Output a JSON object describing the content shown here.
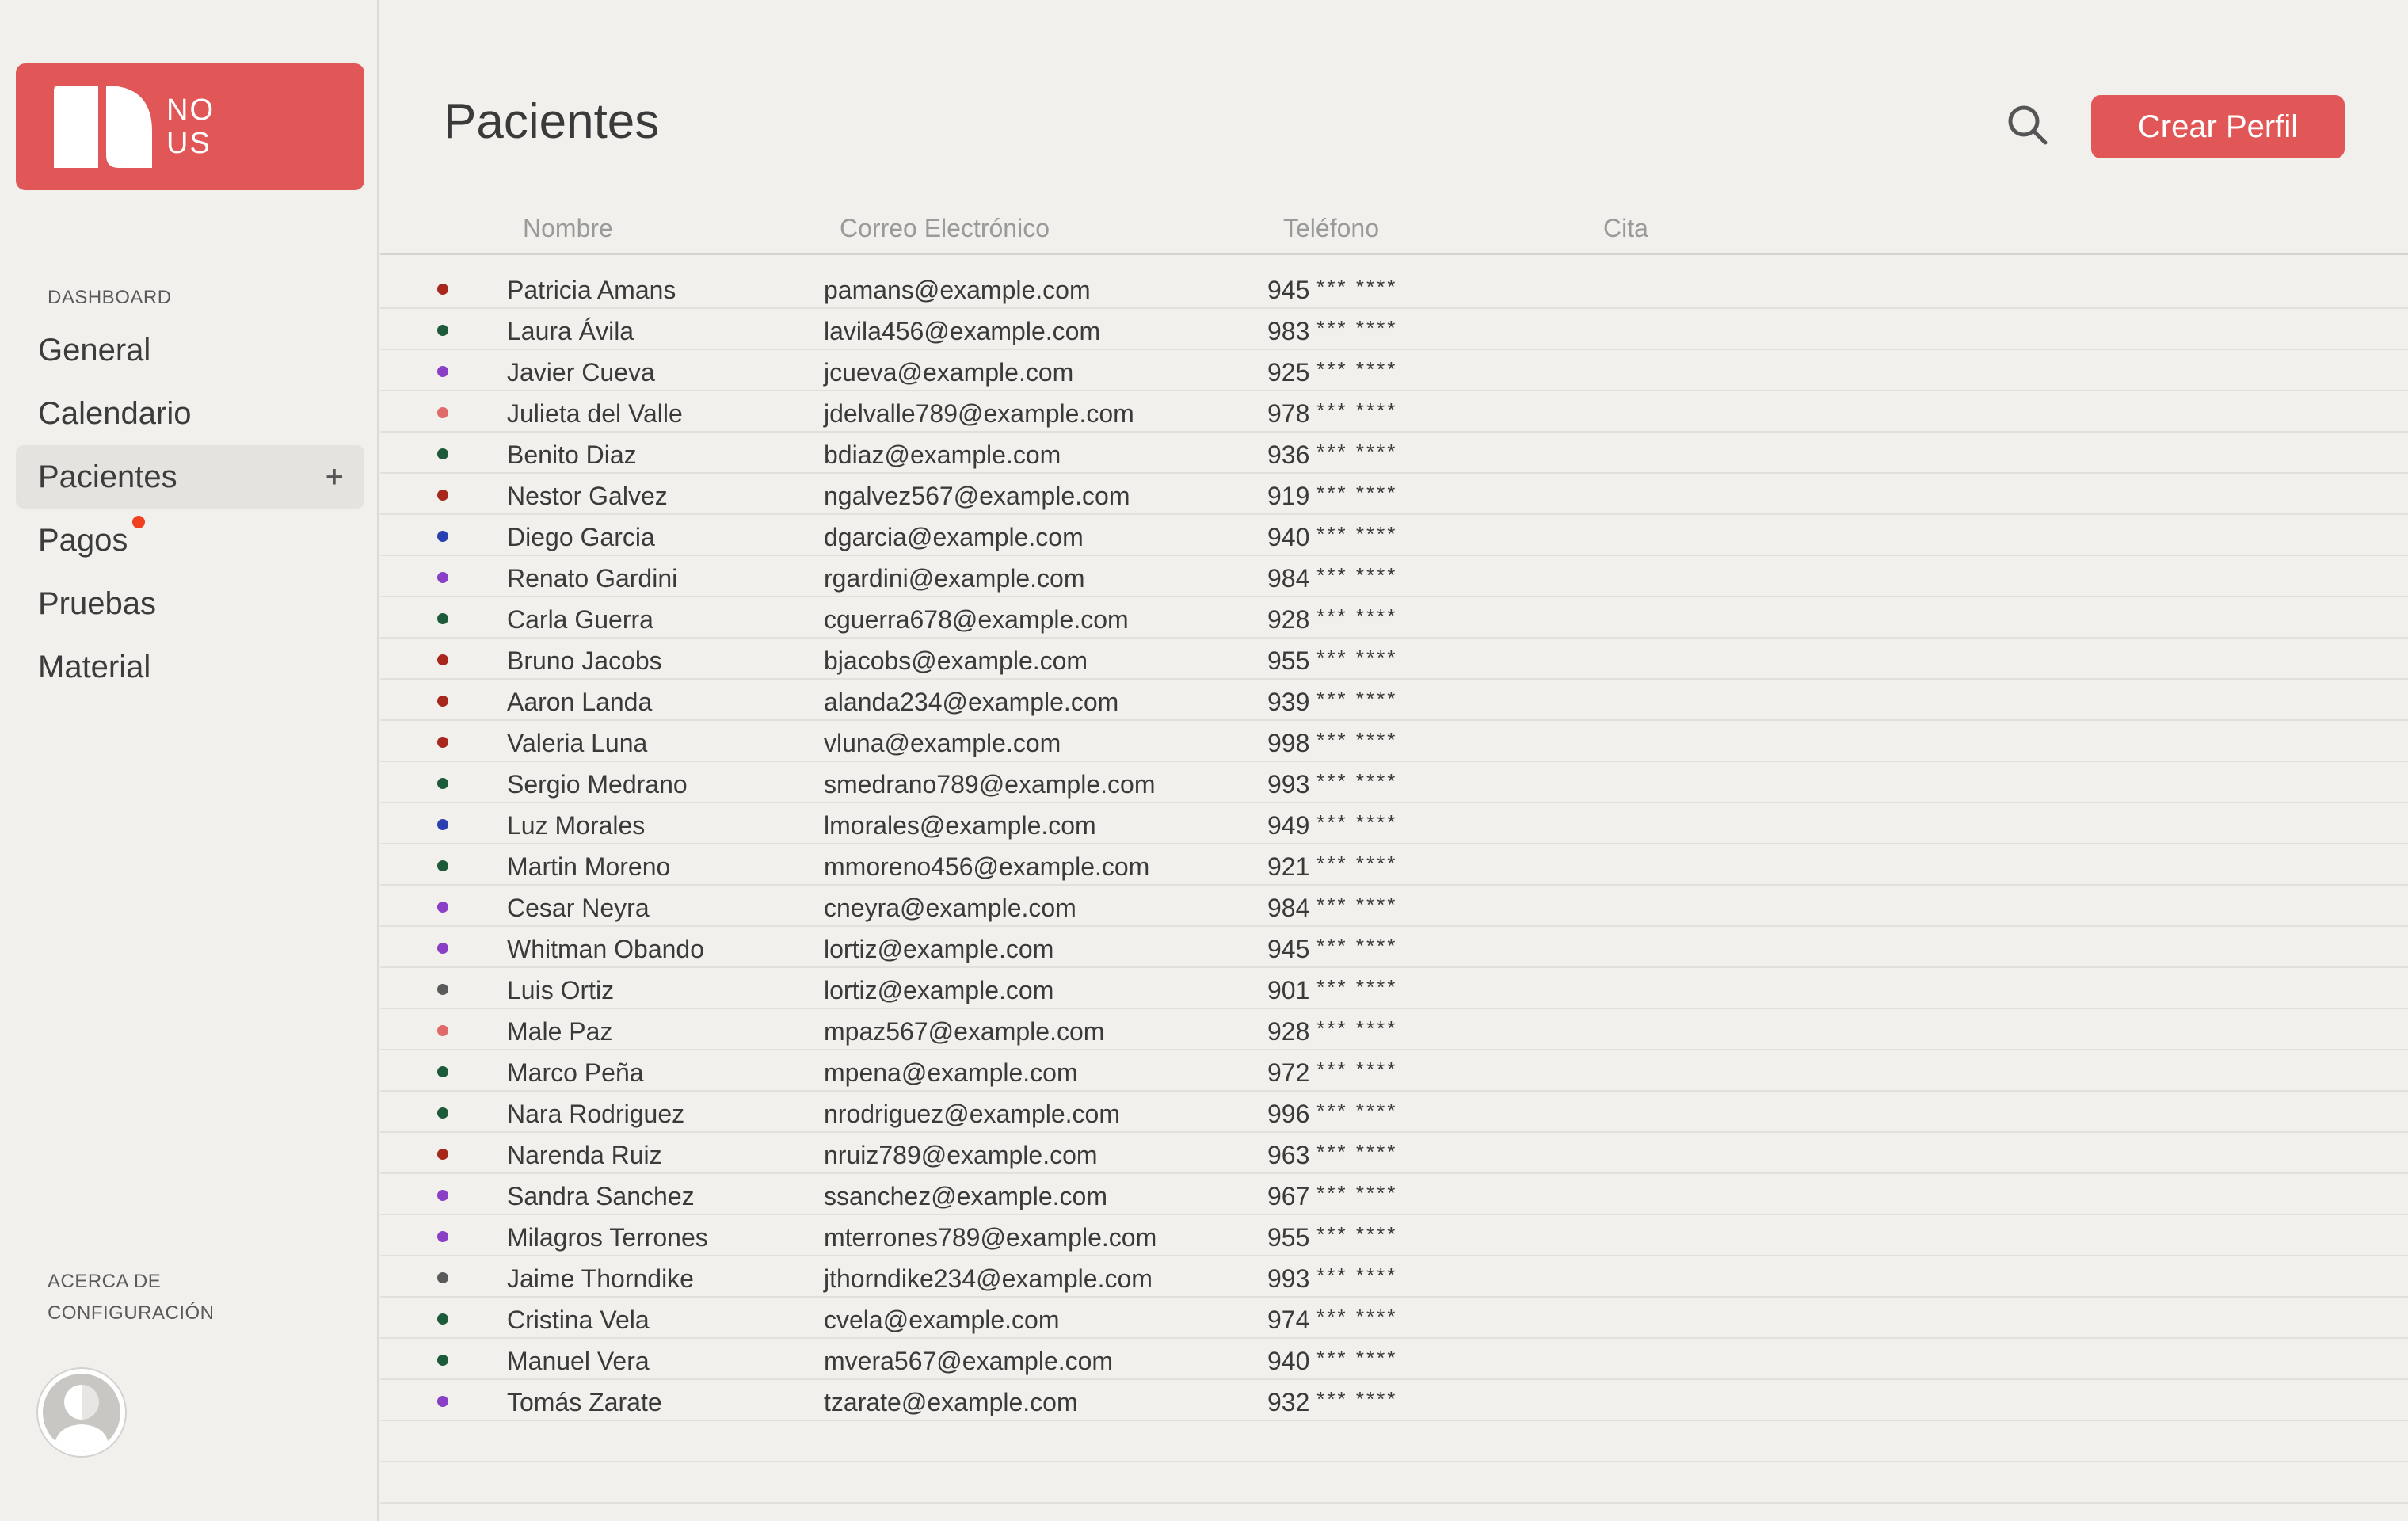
{
  "brand": {
    "line1": "NO",
    "line2": "US",
    "color": "#e15757"
  },
  "sidebar": {
    "section_dashboard": "DASHBOARD",
    "items": [
      {
        "label": "General",
        "active": false
      },
      {
        "label": "Calendario",
        "active": false
      },
      {
        "label": "Pacientes",
        "active": true,
        "action": "+"
      },
      {
        "label": "Pagos",
        "active": false,
        "badge": true
      },
      {
        "label": "Pruebas",
        "active": false
      },
      {
        "label": "Material",
        "active": false
      }
    ],
    "footer_line1": "ACERCA DE",
    "footer_line2": "CONFIGURACIÓN"
  },
  "header": {
    "title": "Pacientes",
    "create_button": "Crear Perfil",
    "search_icon": "search-icon"
  },
  "table": {
    "columns": [
      "Nombre",
      "Correo Electrónico",
      "Teléfono",
      "Cita"
    ],
    "mask": "*** ****",
    "rows": [
      {
        "name": "Patricia Amans",
        "email": "pamans@example.com",
        "phone": "945",
        "color": "#a8271d"
      },
      {
        "name": "Laura Ávila",
        "email": "lavila456@example.com",
        "phone": "983",
        "color": "#1d5a3a"
      },
      {
        "name": "Javier Cueva",
        "email": "jcueva@example.com",
        "phone": "925",
        "color": "#8a3fc7"
      },
      {
        "name": "Julieta del Valle",
        "email": "jdelvalle789@example.com",
        "phone": "978",
        "color": "#e06a6a"
      },
      {
        "name": "Benito Diaz",
        "email": "bdiaz@example.com",
        "phone": "936",
        "color": "#1d5a3a"
      },
      {
        "name": "Nestor Galvez",
        "email": "ngalvez567@example.com",
        "phone": "919",
        "color": "#a8271d"
      },
      {
        "name": "Diego Garcia",
        "email": "dgarcia@example.com",
        "phone": "940",
        "color": "#2a3fb0"
      },
      {
        "name": "Renato Gardini",
        "email": "rgardini@example.com",
        "phone": "984",
        "color": "#8a3fc7"
      },
      {
        "name": "Carla Guerra",
        "email": "cguerra678@example.com",
        "phone": "928",
        "color": "#1d5a3a"
      },
      {
        "name": "Bruno Jacobs",
        "email": "bjacobs@example.com",
        "phone": "955",
        "color": "#a8271d"
      },
      {
        "name": "Aaron Landa",
        "email": "alanda234@example.com",
        "phone": "939",
        "color": "#a8271d"
      },
      {
        "name": "Valeria Luna",
        "email": "vluna@example.com",
        "phone": "998",
        "color": "#a8271d"
      },
      {
        "name": "Sergio Medrano",
        "email": "smedrano789@example.com",
        "phone": "993",
        "color": "#1d5a3a"
      },
      {
        "name": "Luz Morales",
        "email": "lmorales@example.com",
        "phone": "949",
        "color": "#2a3fb0"
      },
      {
        "name": "Martin Moreno",
        "email": "mmoreno456@example.com",
        "phone": "921",
        "color": "#1d5a3a"
      },
      {
        "name": "Cesar Neyra",
        "email": "cneyra@example.com",
        "phone": "984",
        "color": "#8a3fc7"
      },
      {
        "name": "Whitman Obando",
        "email": "lortiz@example.com",
        "phone": "945",
        "color": "#8a3fc7"
      },
      {
        "name": "Luis Ortiz",
        "email": "lortiz@example.com",
        "phone": "901",
        "color": "#5a5a5a"
      },
      {
        "name": "Male Paz",
        "email": "mpaz567@example.com",
        "phone": "928",
        "color": "#e06a6a"
      },
      {
        "name": "Marco Peña",
        "email": "mpena@example.com",
        "phone": "972",
        "color": "#1d5a3a"
      },
      {
        "name": "Nara Rodriguez",
        "email": "nrodriguez@example.com",
        "phone": "996",
        "color": "#1d5a3a"
      },
      {
        "name": "Narenda Ruiz",
        "email": "nruiz789@example.com",
        "phone": "963",
        "color": "#a8271d"
      },
      {
        "name": "Sandra Sanchez",
        "email": "ssanchez@example.com",
        "phone": "967",
        "color": "#8a3fc7"
      },
      {
        "name": "Milagros Terrones",
        "email": "mterrones789@example.com",
        "phone": "955",
        "color": "#8a3fc7"
      },
      {
        "name": "Jaime Thorndike",
        "email": "jthorndike234@example.com",
        "phone": "993",
        "color": "#5a5a5a"
      },
      {
        "name": "Cristina Vela",
        "email": "cvela@example.com",
        "phone": "974",
        "color": "#1d5a3a"
      },
      {
        "name": "Manuel Vera",
        "email": "mvera567@example.com",
        "phone": "940",
        "color": "#1d5a3a"
      },
      {
        "name": "Tomás Zarate",
        "email": "tzarate@example.com",
        "phone": "932",
        "color": "#8a3fc7"
      }
    ]
  }
}
